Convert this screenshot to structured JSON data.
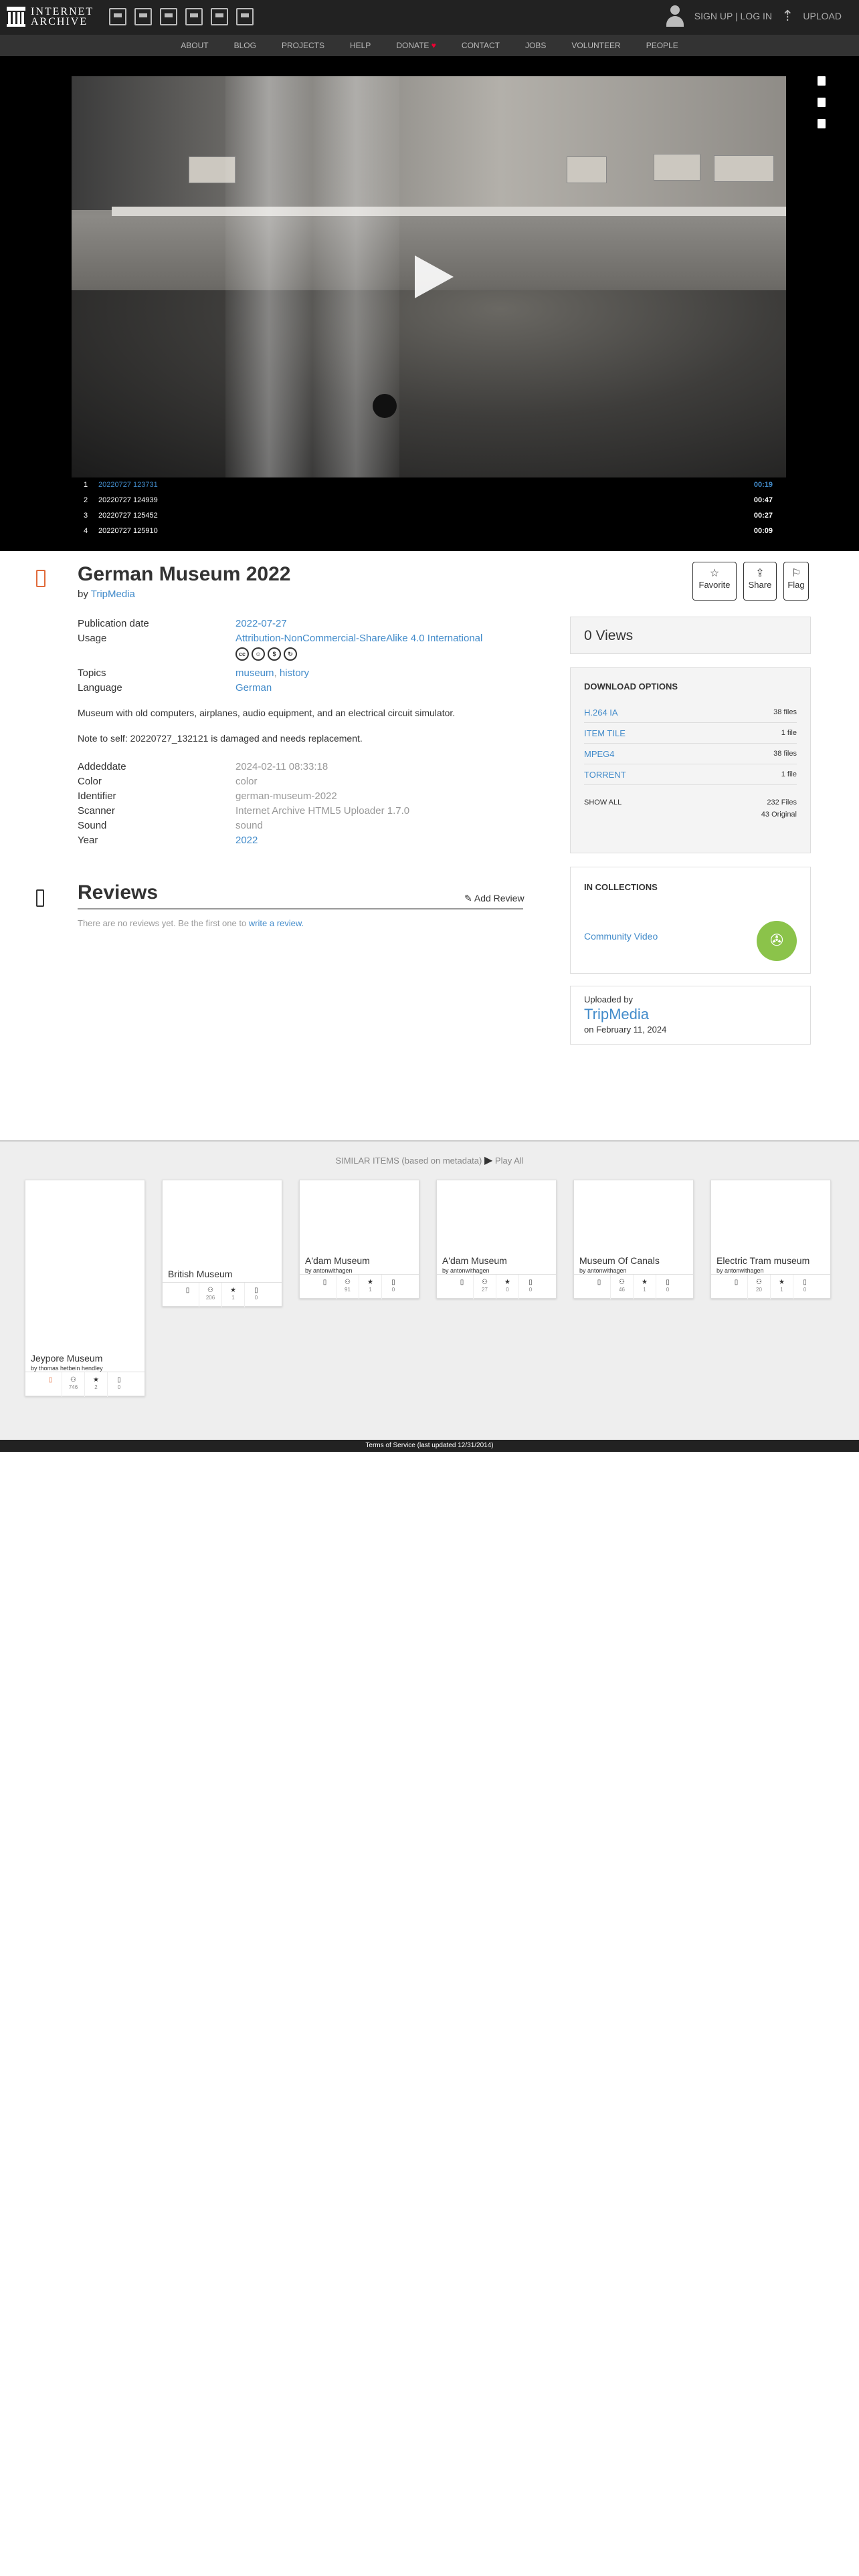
{
  "header": {
    "logo_line1": "INTERNET",
    "logo_line2": "ARCHIVE",
    "media_icons": [
      "web-icon",
      "texts-icon",
      "video-icon",
      "audio-icon",
      "software-icon",
      "images-icon"
    ],
    "signup": "SIGN UP | LOG IN",
    "upload": "UPLOAD"
  },
  "nav": {
    "items": [
      "ABOUT",
      "BLOG",
      "PROJECTS",
      "HELP",
      "DONATE",
      "CONTACT",
      "JOBS",
      "VOLUNTEER",
      "PEOPLE"
    ]
  },
  "playlist": [
    {
      "num": "1",
      "name": "20220727 123731",
      "time": "00:19"
    },
    {
      "num": "2",
      "name": "20220727 124939",
      "time": "00:47"
    },
    {
      "num": "3",
      "name": "20220727 125452",
      "time": "00:27"
    },
    {
      "num": "4",
      "name": "20220727 125910",
      "time": "00:09"
    }
  ],
  "item": {
    "title": "German Museum 2022",
    "by_label": "by",
    "by": "TripMedia",
    "favorite": "Favorite",
    "share": "Share",
    "flag": "Flag",
    "pub_key": "Publication date",
    "pub_val": "2022-07-27",
    "usage_key": "Usage",
    "usage_val": "Attribution-NonCommercial-ShareAlike 4.0 International",
    "topics_key": "Topics",
    "topic1": "museum",
    "topic_sep": ", ",
    "topic2": "history",
    "lang_key": "Language",
    "lang_val": "German",
    "desc1": "Museum with old computers, airplanes, audio equipment, and an electrical circuit simulator.",
    "desc2": "Note to self: 20220727_132121 is damaged and needs replacement.",
    "addeddate_key": "Addeddate",
    "addeddate_val": "2024-02-11 08:33:18",
    "color_key": "Color",
    "color_val": "color",
    "identifier_key": "Identifier",
    "identifier_val": "german-museum-2022",
    "scanner_key": "Scanner",
    "scanner_val": "Internet Archive HTML5 Uploader 1.7.0",
    "sound_key": "Sound",
    "sound_val": "sound",
    "year_key": "Year",
    "year_val": "2022"
  },
  "reviews": {
    "title": "Reviews",
    "add": "Add Review",
    "empty_prefix": "There are no reviews yet. Be the first one to ",
    "empty_link": "write a review."
  },
  "sidebar": {
    "views": "0 Views",
    "download_title": "DOWNLOAD OPTIONS",
    "downloads": [
      {
        "name": "H.264 IA",
        "count": "38 files"
      },
      {
        "name": "ITEM TILE",
        "count": "1 file"
      },
      {
        "name": "MPEG4",
        "count": "38 files"
      },
      {
        "name": "TORRENT",
        "count": "1 file"
      }
    ],
    "show_all": "SHOW ALL",
    "total_files": "232 Files",
    "original": "43 Original",
    "collections_title": "IN COLLECTIONS",
    "collection": "Community Video",
    "uploaded_by_label": "Uploaded by",
    "uploader": "TripMedia",
    "uploaded_on": "on February 11, 2024"
  },
  "similar": {
    "heading": "SIMILAR ITEMS (based on metadata)",
    "play_all": "Play All",
    "cards": [
      {
        "title": "Jeypore Museum",
        "by": "by thomas hetbein hendley",
        "views": "746",
        "favs": "2",
        "reviews": "0"
      },
      {
        "title": "British Museum",
        "by": "",
        "views": "206",
        "favs": "1",
        "reviews": "0"
      },
      {
        "title": "A'dam Museum",
        "by": "by antonwithagen",
        "views": "91",
        "favs": "1",
        "reviews": "0"
      },
      {
        "title": "A'dam Museum",
        "by": "by antonwithagen",
        "views": "27",
        "favs": "0",
        "reviews": "0"
      },
      {
        "title": "Museum Of Canals",
        "by": "by antonwithagen",
        "views": "46",
        "favs": "1",
        "reviews": "0"
      },
      {
        "title": "Electric Tram museum",
        "by": "by antonwithagen",
        "views": "20",
        "favs": "1",
        "reviews": "0"
      }
    ]
  },
  "footer": {
    "text": "Terms of Service (last updated 12/31/2014)"
  }
}
